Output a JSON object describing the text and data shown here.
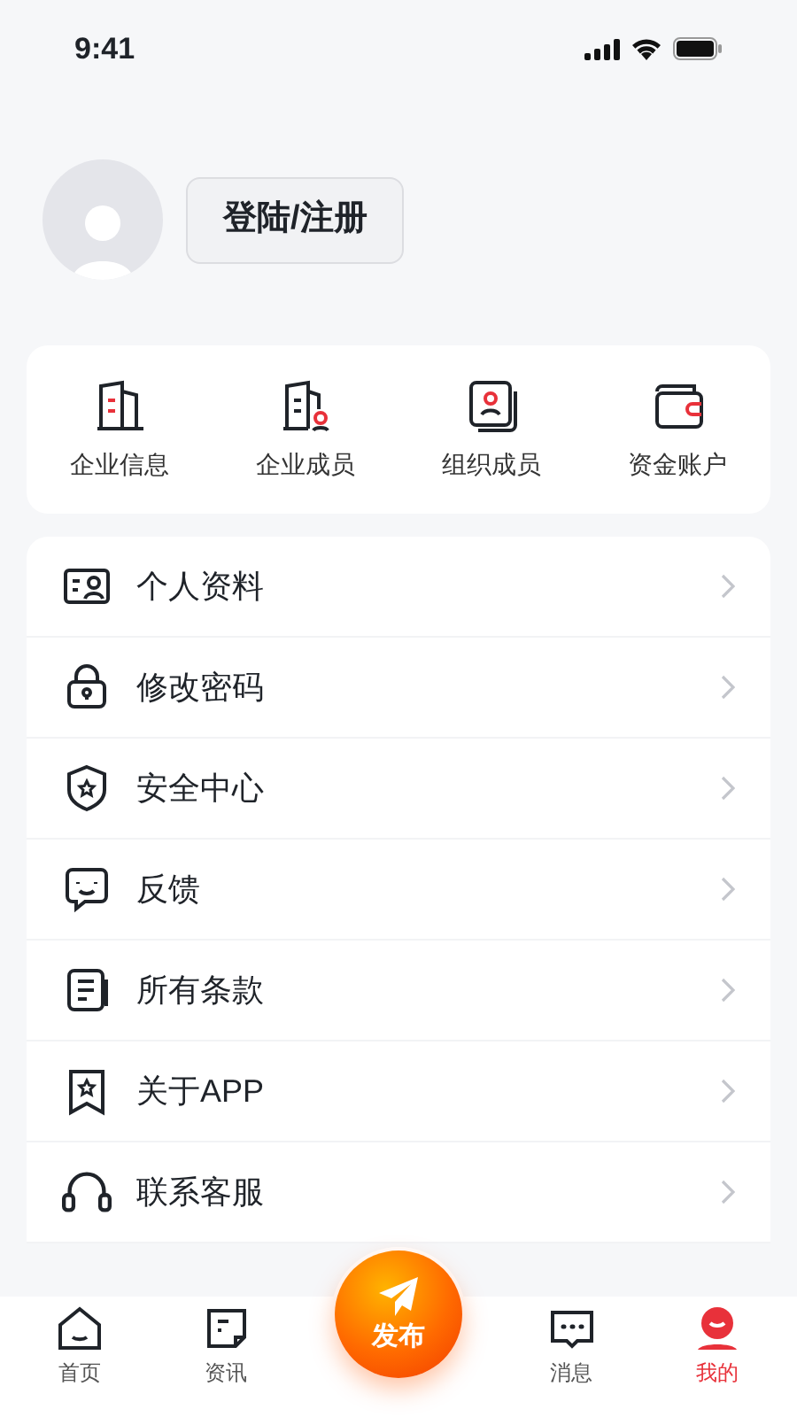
{
  "status_bar": {
    "time": "9:41"
  },
  "profile": {
    "login_button": "登陆/注册"
  },
  "quick_actions": [
    {
      "label": "企业信息"
    },
    {
      "label": "企业成员"
    },
    {
      "label": "组织成员"
    },
    {
      "label": "资金账户"
    }
  ],
  "menu": [
    {
      "label": "个人资料"
    },
    {
      "label": "修改密码"
    },
    {
      "label": "安全中心"
    },
    {
      "label": "反馈"
    },
    {
      "label": "所有条款"
    },
    {
      "label": "关于APP"
    },
    {
      "label": "联系客服"
    }
  ],
  "tab_bar": {
    "tabs": [
      {
        "label": "首页",
        "selected": false
      },
      {
        "label": "资讯",
        "selected": false
      },
      {
        "label": "消息",
        "selected": false
      },
      {
        "label": "我的",
        "selected": true
      }
    ],
    "publish_button": "发布"
  }
}
